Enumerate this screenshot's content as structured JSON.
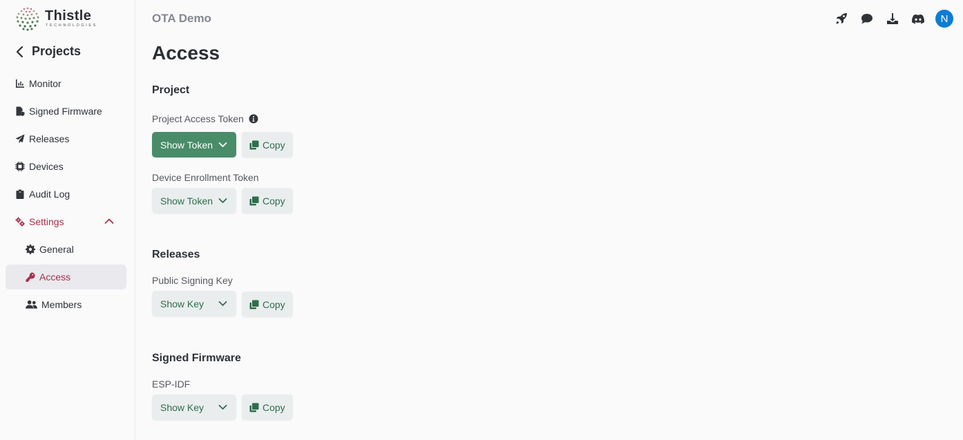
{
  "brand": {
    "name": "Thistle",
    "subtitle": "TECHNOLOGIES"
  },
  "sidebar": {
    "back_label": "Projects",
    "items": [
      {
        "label": "Monitor",
        "icon": "chart-bar-icon"
      },
      {
        "label": "Signed Firmware",
        "icon": "file-shield-icon"
      },
      {
        "label": "Releases",
        "icon": "paper-plane-icon"
      },
      {
        "label": "Devices",
        "icon": "microchip-icon"
      },
      {
        "label": "Audit Log",
        "icon": "clipboard-icon"
      },
      {
        "label": "Settings",
        "icon": "gears-icon",
        "expanded": true
      },
      {
        "label": "General",
        "icon": "gear-icon"
      },
      {
        "label": "Access",
        "icon": "key-icon",
        "active": true
      },
      {
        "label": "Members",
        "icon": "users-icon"
      }
    ]
  },
  "header": {
    "project_name": "OTA Demo",
    "icons": [
      "rocket-icon",
      "comment-icon",
      "download-icon",
      "discord-icon"
    ],
    "avatar_initial": "N",
    "avatar_color": "#0d7dd4"
  },
  "main": {
    "title": "Access",
    "sections": [
      {
        "title": "Project",
        "fields": [
          {
            "label": "Project Access Token",
            "has_info": true,
            "show_label": "Show Token",
            "copy_label": "Copy",
            "primary": true
          },
          {
            "label": "Device Enrollment Token",
            "show_label": "Show Token",
            "copy_label": "Copy"
          }
        ]
      },
      {
        "title": "Releases",
        "fields": [
          {
            "label": "Public Signing Key",
            "show_label": "Show Key",
            "copy_label": "Copy"
          }
        ]
      },
      {
        "title": "Signed Firmware",
        "fields": [
          {
            "label": "ESP-IDF",
            "show_label": "Show Key",
            "copy_label": "Copy"
          }
        ]
      }
    ]
  },
  "colors": {
    "accent": "#a72f4c",
    "primary_button": "#488c68",
    "secondary_text": "#2f6e4b"
  }
}
